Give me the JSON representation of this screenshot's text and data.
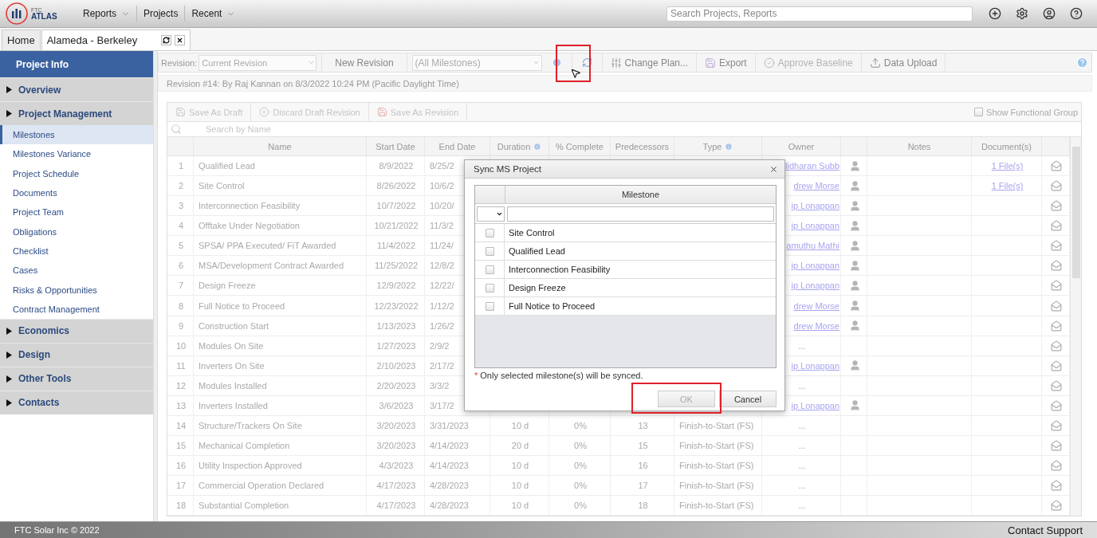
{
  "app": {
    "logo_small": "FTC",
    "logo": "ATLAS"
  },
  "nav": [
    {
      "label": "Reports",
      "dropdown": true
    },
    {
      "label": "Projects",
      "dropdown": false
    },
    {
      "label": "Recent",
      "dropdown": true
    }
  ],
  "search": {
    "placeholder": "Search Projects, Reports"
  },
  "tabs": [
    {
      "label": "Home",
      "selected": false,
      "closable": false
    },
    {
      "label": "Alameda - Berkeley",
      "selected": true,
      "closable": true
    }
  ],
  "sidebar": {
    "title": "Project Info",
    "groups": [
      {
        "label": "Overview"
      },
      {
        "label": "Project Management",
        "items": [
          {
            "label": "Milestones",
            "selected": true
          },
          {
            "label": "Milestones Variance",
            "selected": false
          },
          {
            "label": "Project Schedule",
            "selected": false
          },
          {
            "label": "Documents",
            "selected": false
          },
          {
            "label": "Project Team",
            "selected": false
          },
          {
            "label": "Obligations",
            "selected": false
          },
          {
            "label": "Checklist",
            "selected": false
          },
          {
            "label": "Cases",
            "selected": false
          },
          {
            "label": "Risks & Opportunities",
            "selected": false
          },
          {
            "label": "Contract Management",
            "selected": false
          }
        ]
      },
      {
        "label": "Economics"
      },
      {
        "label": "Design"
      },
      {
        "label": "Other Tools"
      },
      {
        "label": "Contacts"
      }
    ]
  },
  "toolbar": {
    "revision_label": "Revision:",
    "revision": "Current Revision",
    "new_revision": "New Revision",
    "milestone_filter": "(All Milestones)",
    "buttons": [
      {
        "label": "Change Plan...",
        "kind": "plan",
        "disabled": false
      },
      {
        "label": "Export",
        "kind": "export",
        "disabled": false
      },
      {
        "label": "Approve Baseline",
        "kind": "approve",
        "disabled": true
      },
      {
        "label": "Data Upload",
        "kind": "upload",
        "disabled": false
      }
    ]
  },
  "revision_info": "Revision #14: By Raj Kannan on 8/3/2022 10:24 PM (Pacific Daylight Time)",
  "grid": {
    "actions": [
      {
        "label": "Save As Draft",
        "kind": "draft"
      },
      {
        "label": "Discard Draft Revision",
        "kind": "discard"
      },
      {
        "label": "Save As Revision",
        "kind": "revision"
      }
    ],
    "show_functional_group": {
      "label": "Show Functional Group",
      "checked": false
    },
    "search_placeholder": "Search by Name",
    "columns": [
      {
        "label": "Name",
        "info": false
      },
      {
        "label": "Start Date",
        "info": false
      },
      {
        "label": "End Date",
        "info": false
      },
      {
        "label": "Duration",
        "info": true
      },
      {
        "label": "% Complete",
        "info": false
      },
      {
        "label": "Predecessors",
        "info": false
      },
      {
        "label": "Type",
        "info": true
      },
      {
        "label": "Owner",
        "info": false
      },
      {
        "label": "Notes",
        "info": false
      },
      {
        "label": "Document(s)",
        "info": false
      }
    ],
    "rows": [
      {
        "number": "1",
        "name": "Qualified Lead",
        "start": "8/9/2022",
        "end": "8/25/2",
        "owner": "lidharan Subb",
        "linked": true,
        "owner_icon": true,
        "documents": "1 File(s)"
      },
      {
        "number": "2",
        "name": "Site Control",
        "start": "8/26/2022",
        "end": "10/6/2",
        "owner": "drew Morse",
        "linked": true,
        "owner_icon": true,
        "documents": "1 File(s)"
      },
      {
        "number": "3",
        "name": "Interconnection Feasibility",
        "start": "10/7/2022",
        "end": "10/20/",
        "owner": "ip Lonappan",
        "linked": true,
        "owner_icon": true
      },
      {
        "number": "4",
        "name": "Offtake Under Negotiation",
        "start": "10/21/2022",
        "end": "11/3/2",
        "owner": "ip Lonappan",
        "linked": true,
        "owner_icon": true
      },
      {
        "number": "5",
        "name": "SPSA/ PPA Executed/ FiT Awarded",
        "start": "11/4/2022",
        "end": "11/24/",
        "owner": "amuthu Mathi",
        "linked": true,
        "owner_icon": true
      },
      {
        "number": "6",
        "name": "MSA/Development Contract Awarded",
        "start": "11/25/2022",
        "end": "12/8/2",
        "owner": "ip Lonappan",
        "linked": true,
        "owner_icon": true
      },
      {
        "number": "7",
        "name": "Design Freeze",
        "start": "12/9/2022",
        "end": "12/22/",
        "owner": "ip Lonappan",
        "linked": true,
        "owner_icon": true
      },
      {
        "number": "8",
        "name": "Full Notice to Proceed",
        "start": "12/23/2022",
        "end": "1/12/2",
        "owner": "drew Morse",
        "linked": true,
        "owner_icon": true
      },
      {
        "number": "9",
        "name": "Construction Start",
        "start": "1/13/2023",
        "end": "1/26/2",
        "owner": "drew Morse",
        "linked": true,
        "owner_icon": true
      },
      {
        "number": "10",
        "name": "Modules On Site",
        "start": "1/27/2023",
        "end": "2/9/2",
        "owner": "...",
        "linked": false,
        "owner_icon": false
      },
      {
        "number": "11",
        "name": "Inverters On Site",
        "start": "2/10/2023",
        "end": "2/17/2",
        "owner": "ip Lonappan",
        "linked": true,
        "owner_icon": true
      },
      {
        "number": "12",
        "name": "Modules Installed",
        "start": "2/20/2023",
        "end": "3/3/2",
        "owner": "...",
        "linked": false,
        "owner_icon": false
      },
      {
        "number": "13",
        "name": "Inverters Installed",
        "start": "3/6/2023",
        "end": "3/17/2",
        "owner": "ip Lonappan",
        "linked": true,
        "owner_icon": true
      },
      {
        "number": "14",
        "name": "Structure/Trackers On Site",
        "start": "3/20/2023",
        "end": "3/31/2023",
        "duration": "10 d",
        "complete": "0%",
        "predecessors": "13",
        "type": "Finish-to-Start (FS)",
        "owner": "...",
        "linked": false,
        "owner_icon": false
      },
      {
        "number": "15",
        "name": "Mechanical Completion",
        "start": "3/20/2023",
        "end": "4/14/2023",
        "duration": "20 d",
        "complete": "0%",
        "predecessors": "15",
        "type": "Finish-to-Start (FS)",
        "owner": "...",
        "linked": false,
        "owner_icon": false
      },
      {
        "number": "16",
        "name": "Utility Inspection Approved",
        "start": "4/3/2023",
        "end": "4/14/2023",
        "duration": "10 d",
        "complete": "0%",
        "predecessors": "16",
        "type": "Finish-to-Start (FS)",
        "owner": "...",
        "linked": false,
        "owner_icon": false
      },
      {
        "number": "17",
        "name": "Commercial Operation Declared",
        "start": "4/17/2023",
        "end": "4/28/2023",
        "duration": "10 d",
        "complete": "0%",
        "predecessors": "17",
        "type": "Finish-to-Start (FS)",
        "owner": "...",
        "linked": false,
        "owner_icon": false
      },
      {
        "number": "18",
        "name": "Substantial Completion",
        "start": "4/17/2023",
        "end": "4/28/2023",
        "duration": "10 d",
        "complete": "0%",
        "predecessors": "18",
        "type": "Finish-to-Start (FS)",
        "owner": "...",
        "linked": false,
        "owner_icon": false
      }
    ]
  },
  "dialog": {
    "title": "Sync MS Project",
    "column": "Milestone",
    "rows": [
      {
        "label": "Site Control",
        "checked": false
      },
      {
        "label": "Qualified Lead",
        "checked": false
      },
      {
        "label": "Interconnection Feasibility",
        "checked": false
      },
      {
        "label": "Design Freeze",
        "checked": false
      },
      {
        "label": "Full Notice to Proceed",
        "checked": false
      }
    ],
    "note_mark": "*",
    "note": "Only selected milestone(s) will be synced.",
    "buttons": [
      {
        "label": "OK",
        "disabled": true
      },
      {
        "label": "Cancel",
        "disabled": false
      }
    ]
  },
  "footer": {
    "copyright": "FTC Solar Inc © 2022",
    "support": "Contact Support"
  }
}
